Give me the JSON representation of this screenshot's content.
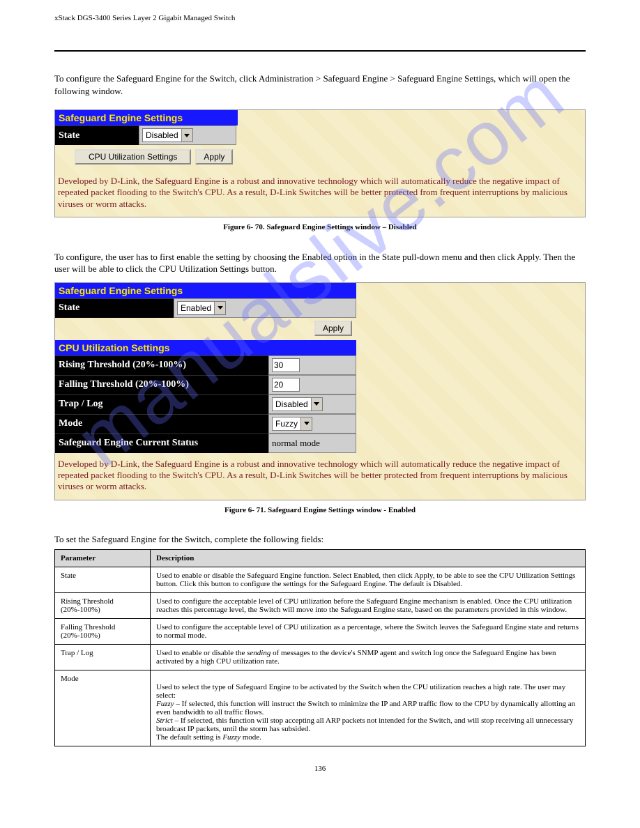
{
  "header": {
    "left": "xStack DGS-3400 Series Layer 2 Gigabit Managed Switch",
    "right": ""
  },
  "intro": "To configure the Safeguard Engine for the Switch, click Administration > Safeguard Engine > Safeguard Engine Settings, which will open the following window.",
  "figure1": {
    "title": "Safeguard Engine Settings",
    "state_label": "State",
    "state_value": "Disabled",
    "cpu_button": "CPU Utilization Settings",
    "apply": "Apply",
    "description": "Developed by D-Link, the Safeguard Engine is a robust and innovative technology which will automatically reduce the negative impact of repeated packet flooding to the Switch's CPU. As a result, D-Link Switches will be better protected from frequent interruptions by malicious viruses or worm attacks.",
    "caption": "Figure 6- 70. Safeguard Engine Settings window – Disabled"
  },
  "between": "To configure, the user has to first enable the setting by choosing the Enabled option in the State pull-down menu and then click Apply. Then the user will be able to click the CPU Utilization Settings button.",
  "figure2": {
    "title": "Safeguard Engine Settings",
    "state_label": "State",
    "state_value": "Enabled",
    "apply": "Apply",
    "sub_title": "CPU Utilization Settings",
    "rising_label": "Rising Threshold (20%-100%)",
    "rising_value": "30",
    "falling_label": "Falling Threshold (20%-100%)",
    "falling_value": "20",
    "trap_label": "Trap / Log",
    "trap_value": "Disabled",
    "mode_label": "Mode",
    "mode_value": "Fuzzy",
    "status_label": "Safeguard Engine Current Status",
    "status_value": "normal mode",
    "description": "Developed by D-Link, the Safeguard Engine is a robust and innovative technology which will automatically reduce the negative impact of repeated packet flooding to the Switch's CPU. As a result, D-Link Switches will be better protected from frequent interruptions by malicious viruses or worm attacks.",
    "caption": "Figure 6- 71. Safeguard Engine Settings window - Enabled"
  },
  "params_intro": "To set the Safeguard Engine for the Switch, complete the following fields:",
  "table": {
    "header_param": "Parameter",
    "header_desc": "Description",
    "rows": [
      {
        "param": "State",
        "desc": "Used to enable or disable the Safeguard Engine function. Select Enabled, then click Apply, to be able to see the CPU Utilization Settings button. Click this button to configure the settings for the Safeguard Engine. The default is Disabled."
      },
      {
        "param": "Rising Threshold (20%-100%)",
        "desc": "Used to configure the acceptable level of CPU utilization before the Safeguard Engine mechanism is enabled. Once the CPU utilization reaches this percentage level, the Switch will move into the Safeguard Engine state, based on the parameters provided in this window."
      },
      {
        "param": "Falling Threshold (20%-100%)",
        "desc": "Used to configure the acceptable level of CPU utilization as a percentage, where the Switch leaves the Safeguard Engine state and returns to normal mode."
      },
      {
        "param": "Trap / Log",
        "desc_parts": {
          "p1": "Used to enable or disable the ",
          "p2_italic": "sending",
          "p3": " of messages to the device's SNMP agent and switch log once the Safeguard Engine has been activated by a high CPU utilization rate."
        }
      },
      {
        "param": "Mode",
        "desc_parts": {
          "p1": "Used to select the type of Safeguard Engine to be activated by the Switch when the CPU utilization reaches a high rate. The user may select:\n",
          "p2_italic": "Fuzzy",
          "p3": " – If selected, this function will instruct the Switch to minimize the IP and ARP traffic flow to the CPU by dynamically allotting an even bandwidth to all traffic flows.\n",
          "p4_italic": "Strict",
          "p5": " – If selected, this function will stop accepting all ARP packets not intended for the Switch, and will stop receiving all unnecessary broadcast IP packets, until the storm has subsided.\nThe default setting is ",
          "p6_italic": "Fuzzy",
          "p7": " mode."
        }
      }
    ]
  },
  "footer_page": "136",
  "watermark_text": "manualslive.com"
}
